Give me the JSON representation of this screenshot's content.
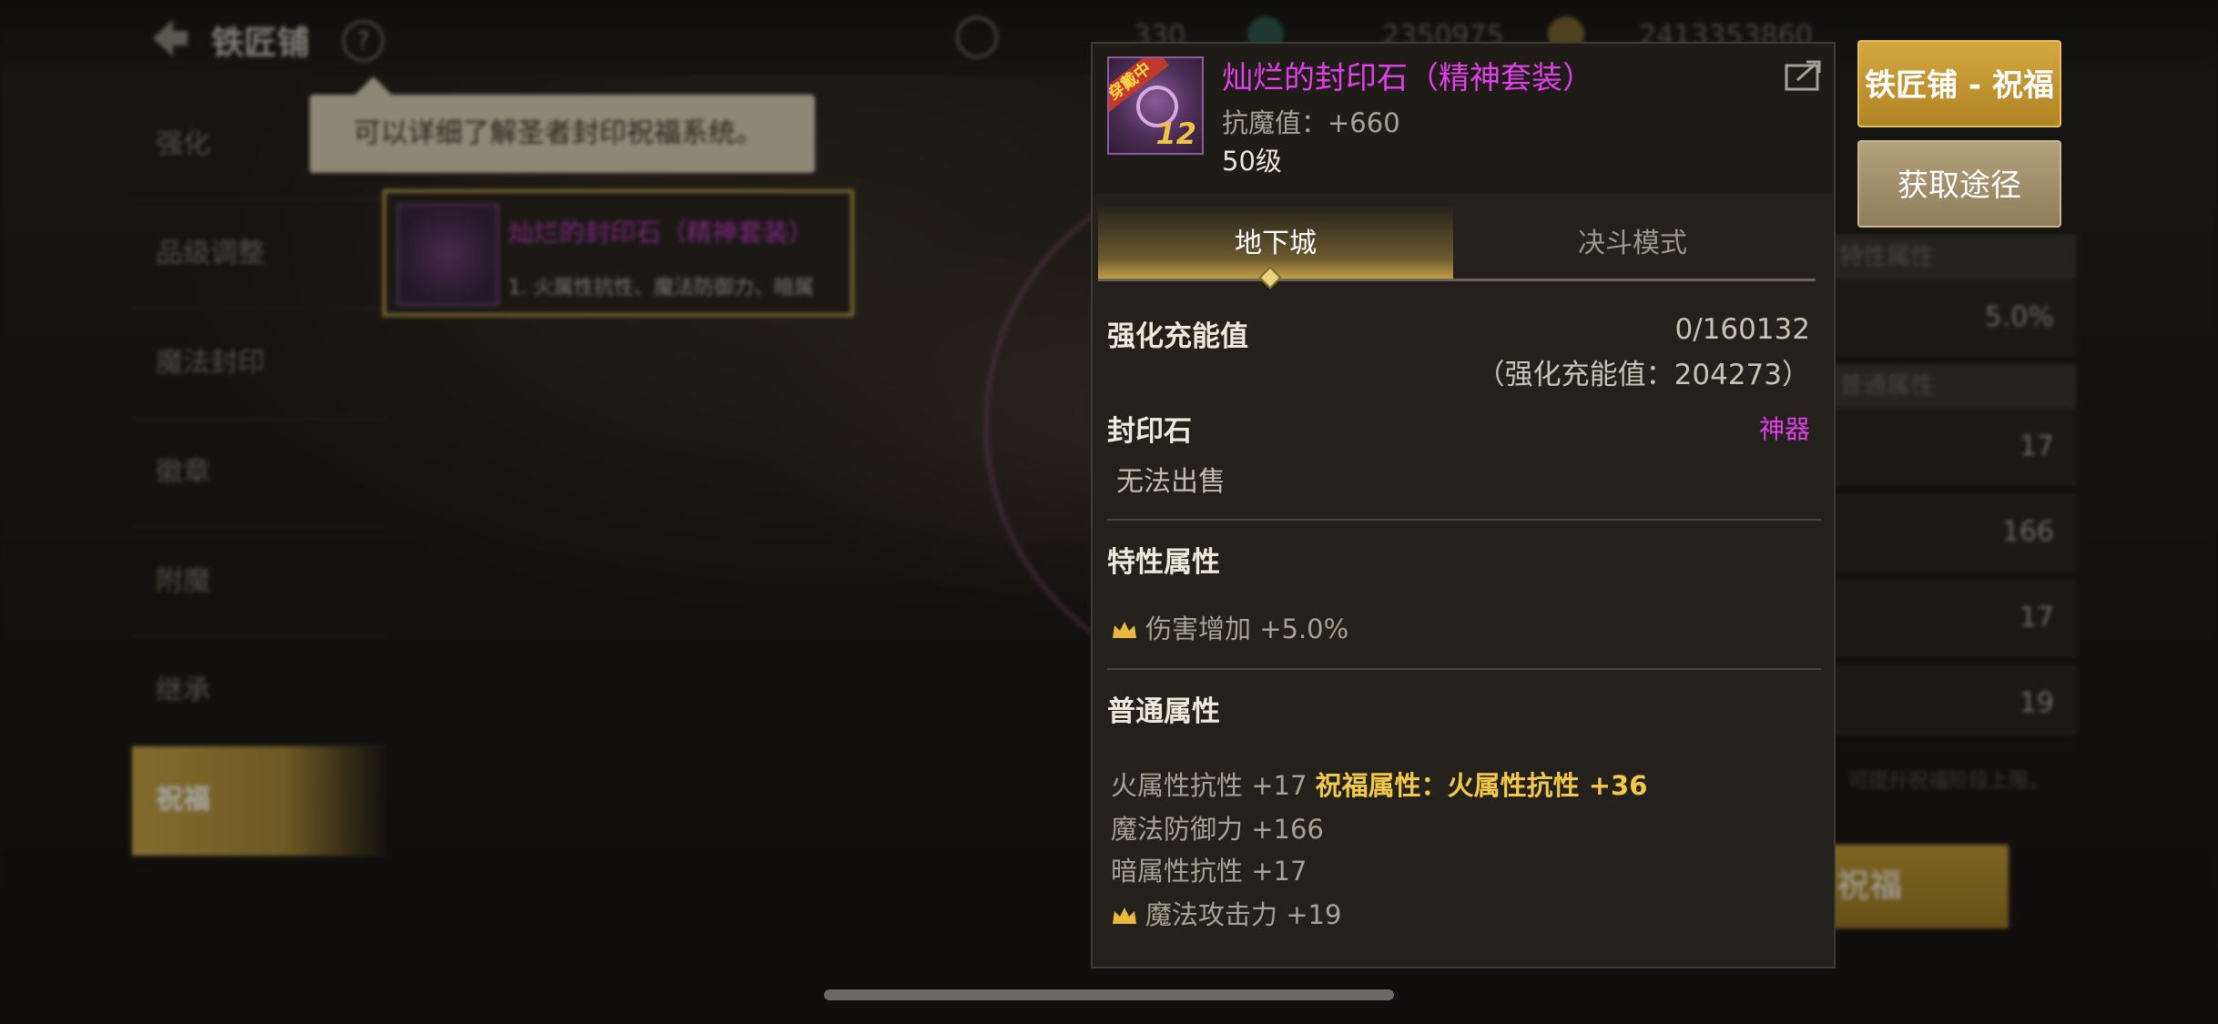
{
  "header": {
    "title": "铁匠铺",
    "help": "?",
    "currencies": [
      "330",
      "2350975",
      "2413353860"
    ]
  },
  "sidebar": {
    "items": [
      {
        "label": "强化"
      },
      {
        "label": "品级调整"
      },
      {
        "label": "魔法封印"
      },
      {
        "label": "徽章"
      },
      {
        "label": "附魔"
      },
      {
        "label": "继承"
      },
      {
        "label": "祝福"
      }
    ]
  },
  "hint": {
    "text": "可以详细了解圣者封印祝福系统。"
  },
  "item_card": {
    "name": "灿烂的封印石（精神套装）",
    "desc": "1. 火属性抗性、魔法防御力、暗属"
  },
  "right_panel": {
    "head1": "特性属性",
    "percent": "5.0%",
    "head2": "普通属性",
    "rows": [
      "17",
      "166",
      "17",
      "19"
    ],
    "bonus": "(+36)",
    "note": "可提升祝福阶段上限。",
    "bless_button": "祝福"
  },
  "popup": {
    "icon": {
      "tag": "穿戴中",
      "level": "12"
    },
    "name": "灿烂的封印石（精神套装）",
    "stat": "抗魔值：+660",
    "level": "50级",
    "tabs": [
      {
        "label": "地下城",
        "active": true
      },
      {
        "label": "决斗模式",
        "active": false
      }
    ],
    "charge": {
      "label": "强化充能值",
      "value": "0/160132",
      "sub": "（强化充能值：204273）"
    },
    "seal": {
      "label": "封印石",
      "rarity": "神器",
      "sell": "无法出售"
    },
    "special": {
      "label": "特性属性",
      "items": [
        "伤害增加 +5.0%"
      ]
    },
    "normal": {
      "label": "普通属性",
      "line1_base": "火属性抗性 +17",
      "line1_bless": "祝福属性：火属性抗性 +36",
      "line2": "魔法防御力 +166",
      "line3": "暗属性抗性 +17",
      "line4": "魔法攻击力 +19"
    }
  },
  "buttons": {
    "bless": "铁匠铺 - 祝福",
    "source": "获取途径"
  },
  "colors": {
    "epic_name": "#e040e8",
    "gold": "#f2c84b",
    "accent_button": "#c9a547"
  }
}
